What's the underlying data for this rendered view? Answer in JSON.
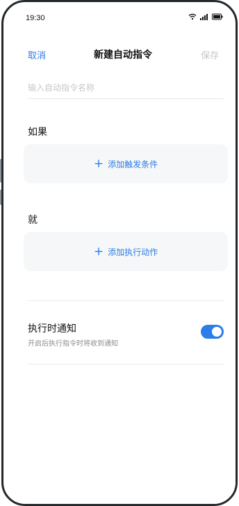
{
  "status_bar": {
    "time": "19:30",
    "icons": [
      "wifi-icon",
      "signal-icon",
      "battery-icon"
    ]
  },
  "nav": {
    "cancel": "取消",
    "title": "新建自动指令",
    "save": "保存"
  },
  "name_input": {
    "placeholder": "输入自动指令名称",
    "value": ""
  },
  "if_section": {
    "label": "如果",
    "add_label": "添加触发条件"
  },
  "then_section": {
    "label": "就",
    "add_label": "添加执行动作"
  },
  "notify": {
    "title": "执行时通知",
    "subtitle": "开启后执行指令时将收到通知",
    "enabled": true
  },
  "colors": {
    "accent": "#2b7de9",
    "disabled": "#c4c6c9",
    "card_bg": "#f6f7f8"
  }
}
